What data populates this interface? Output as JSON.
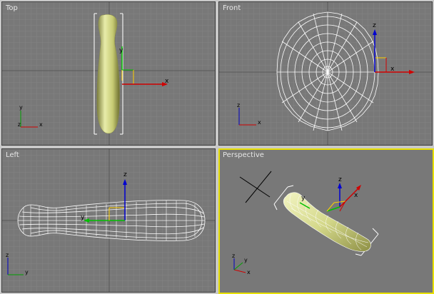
{
  "viewports": {
    "top": {
      "label": "Top"
    },
    "front": {
      "label": "Front"
    },
    "left": {
      "label": "Left"
    },
    "perspective": {
      "label": "Perspective"
    }
  },
  "axes": {
    "x": "x",
    "y": "y",
    "z": "z"
  },
  "colors": {
    "viewport_bg": "#787878",
    "grid_minor": "#848484",
    "grid_major": "#606060",
    "active_border": "#e8e000",
    "wire": "#ffffff",
    "object_fill": "#d8dc8c",
    "x_axis": "#d00000",
    "y_axis": "#00a000",
    "z_axis": "#0000d0"
  }
}
